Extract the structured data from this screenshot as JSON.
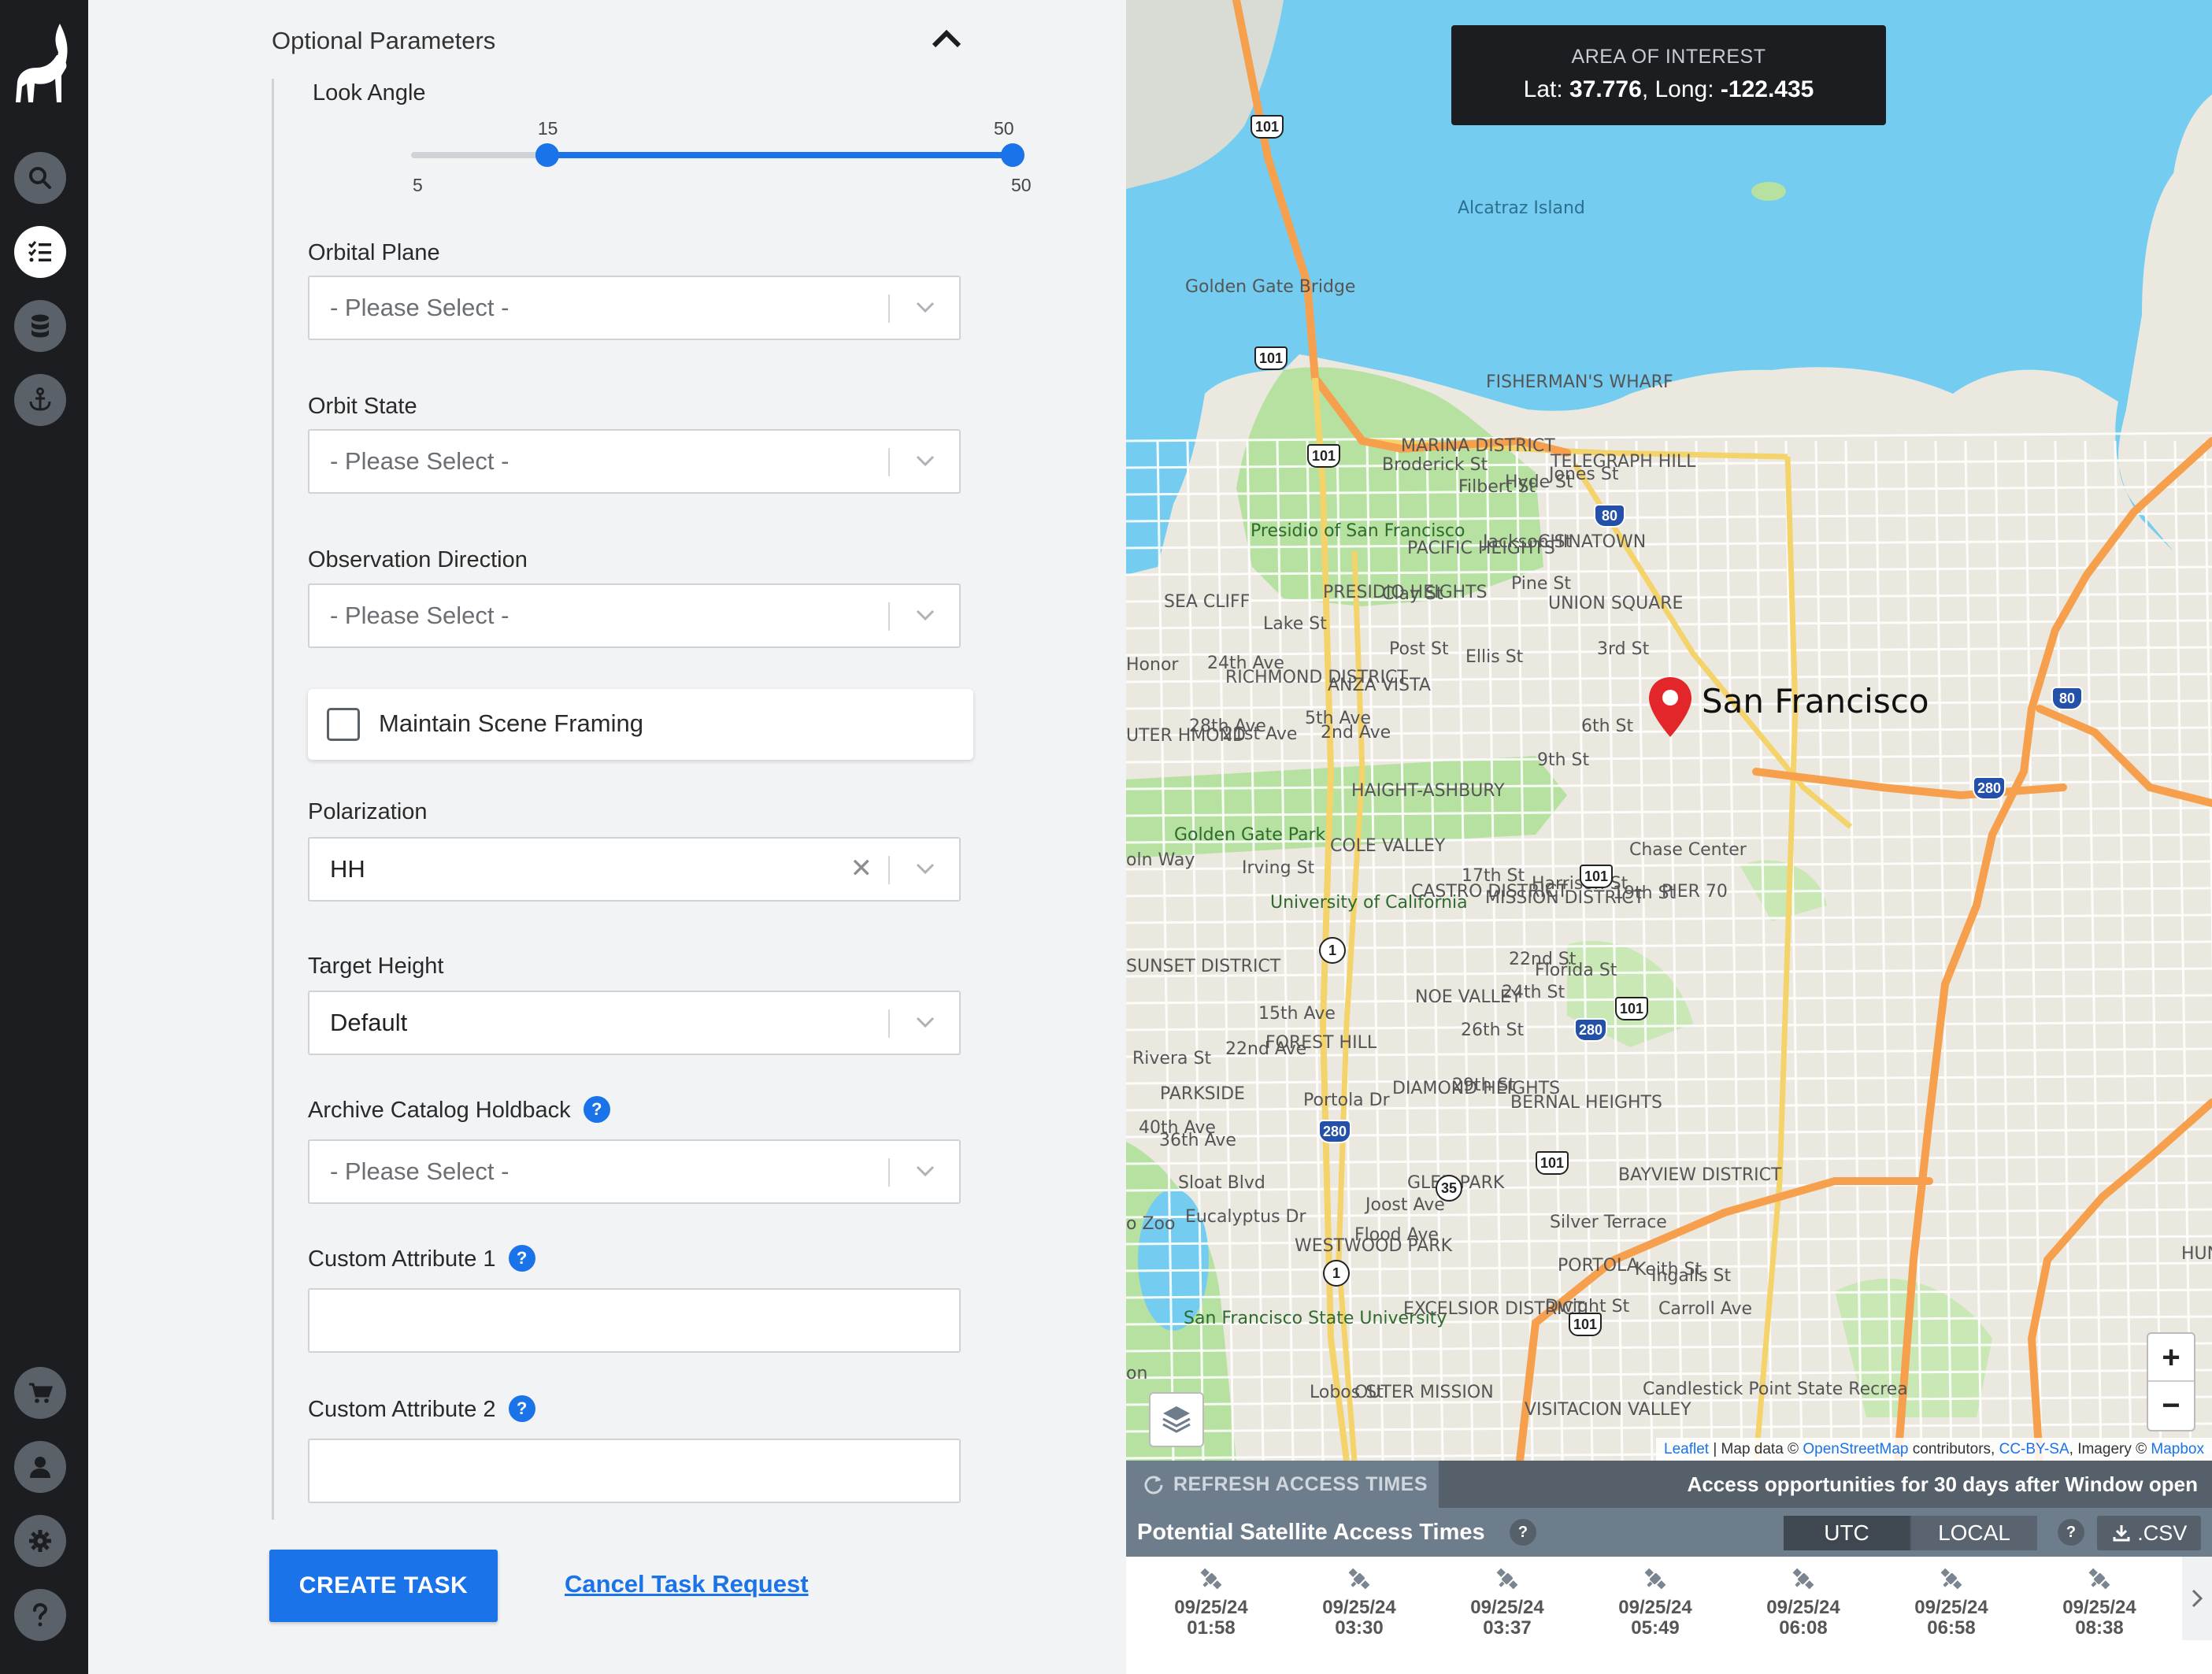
{
  "rail": {
    "items": [
      "search",
      "tasks",
      "database",
      "anchor"
    ],
    "bottom": [
      "cart",
      "user",
      "settings",
      "help"
    ]
  },
  "form": {
    "section_title": "Optional Parameters",
    "look_angle": {
      "label": "Look Angle",
      "min": 5,
      "max": 50,
      "low": 15,
      "high": 50,
      "min_label": "5",
      "max_label": "50",
      "low_label": "15",
      "high_label": "50"
    },
    "orbital_plane": {
      "label": "Orbital Plane",
      "placeholder": "- Please Select -"
    },
    "orbit_state": {
      "label": "Orbit State",
      "placeholder": "- Please Select -"
    },
    "observation_direction": {
      "label": "Observation Direction",
      "placeholder": "- Please Select -"
    },
    "maintain_scene": {
      "label": "Maintain Scene Framing",
      "checked": false
    },
    "polarization": {
      "label": "Polarization",
      "value": "HH"
    },
    "target_height": {
      "label": "Target Height",
      "value": "Default"
    },
    "archive_holdback": {
      "label": "Archive Catalog Holdback",
      "placeholder": "- Please Select -"
    },
    "custom1": {
      "label": "Custom Attribute 1",
      "value": ""
    },
    "custom2": {
      "label": "Custom Attribute 2",
      "value": ""
    },
    "help_glyph": "?",
    "create_label": "CREATE TASK",
    "cancel_label": "Cancel Task Request"
  },
  "map": {
    "aoi_title": "AREA OF INTEREST",
    "lat_label": "Lat:",
    "lat": "37.776",
    "long_label": "Long:",
    "long": "-122.435",
    "city": "San Francisco",
    "zoom_in": "+",
    "zoom_out": "−",
    "labels": [
      "Alcatraz Island",
      "Golden Gate Bridge",
      "FISHERMAN'S WHARF",
      "MARINA DISTRICT",
      "TELEGRAPH HILL",
      "Presidio of San Francisco",
      "PACIFIC HEIGHTS",
      "CHINATOWN",
      "Jackson St",
      "Filbert St",
      "Pine St",
      "UNION SQUARE",
      "SEA CLIFF",
      "Lake St",
      "Clay St",
      "PRESIDIO HEIGHTS",
      "Post St",
      "Ellis St",
      "RICHMOND DISTRICT",
      "ANZA VISTA",
      "HAIGHT-ASHBURY",
      "Golden Gate Park",
      "COLE VALLEY",
      "Irving St",
      "University of California",
      "CASTRO DISTRICT",
      "17th St",
      "MISSION DISTRICT",
      "19th St",
      "Chase Center",
      "PIER 70",
      "SUNSET DISTRICT",
      "NOE VALLEY",
      "22nd St",
      "24th St",
      "FOREST HILL",
      "26th St",
      "PARKSIDE",
      "Rivera St",
      "DIAMOND HEIGHTS",
      "29th St",
      "BERNAL HEIGHTS",
      "Portola Dr",
      "Sloat Blvd",
      "GLEN PARK",
      "Joost Ave",
      "Eucalyptus Dr",
      "Flood Ave",
      "WESTWOOD PARK",
      "Silver Terrace",
      "BAYVIEW DISTRICT",
      "PORTOLA",
      "Dwight St",
      "San Francisco State University",
      "EXCELSIOR DISTRICT",
      "Lobos St",
      "OUTER MISSION",
      "VISITACION VALLEY",
      "Candlestick Point State Recrea",
      "Honor",
      "UTER HMOND",
      "oln Way",
      "o Zoo",
      "on",
      "24th Ave",
      "28th Ave",
      "21st Ave",
      "5th Ave",
      "2nd Ave",
      "15th Ave",
      "22nd Ave",
      "40th Ave",
      "36th Ave",
      "3rd St",
      "6th St",
      "9th St",
      "Broderick St",
      "Hyde St",
      "Jones St",
      "Harrison St",
      "Florida St",
      "Keith St",
      "Ingalls St",
      "Carroll Ave",
      "HUN POI"
    ],
    "shields": [
      "101",
      "101",
      "101",
      "80",
      "80",
      "280",
      "101",
      "101",
      "280",
      "101",
      "101",
      "280",
      "1",
      "1",
      "35"
    ],
    "attribution": {
      "leaflet": "Leaflet",
      "text1": " | Map data © ",
      "osm": "OpenStreetMap",
      "text2": " contributors, ",
      "license": "CC-BY-SA",
      "text3": ", Imagery © ",
      "mapbox": "Mapbox"
    }
  },
  "access": {
    "refresh_label": "REFRESH ACCESS TIMES",
    "note": "Access opportunities for 30 days after Window open",
    "title": "Potential Satellite Access Times",
    "utc": "UTC",
    "local": "LOCAL",
    "csv": ".CSV",
    "times": [
      {
        "date": "09/25/24",
        "time": "01:58"
      },
      {
        "date": "09/25/24",
        "time": "03:30"
      },
      {
        "date": "09/25/24",
        "time": "03:37"
      },
      {
        "date": "09/25/24",
        "time": "05:49"
      },
      {
        "date": "09/25/24",
        "time": "06:08"
      },
      {
        "date": "09/25/24",
        "time": "06:58"
      },
      {
        "date": "09/25/24",
        "time": "08:38"
      }
    ]
  },
  "colors": {
    "accent": "#1a73e8",
    "rail": "#1b1d20",
    "water": "#74cdf0",
    "park": "#b6e1a1",
    "highway": "#f6a04d",
    "pin": "#e3262a"
  }
}
